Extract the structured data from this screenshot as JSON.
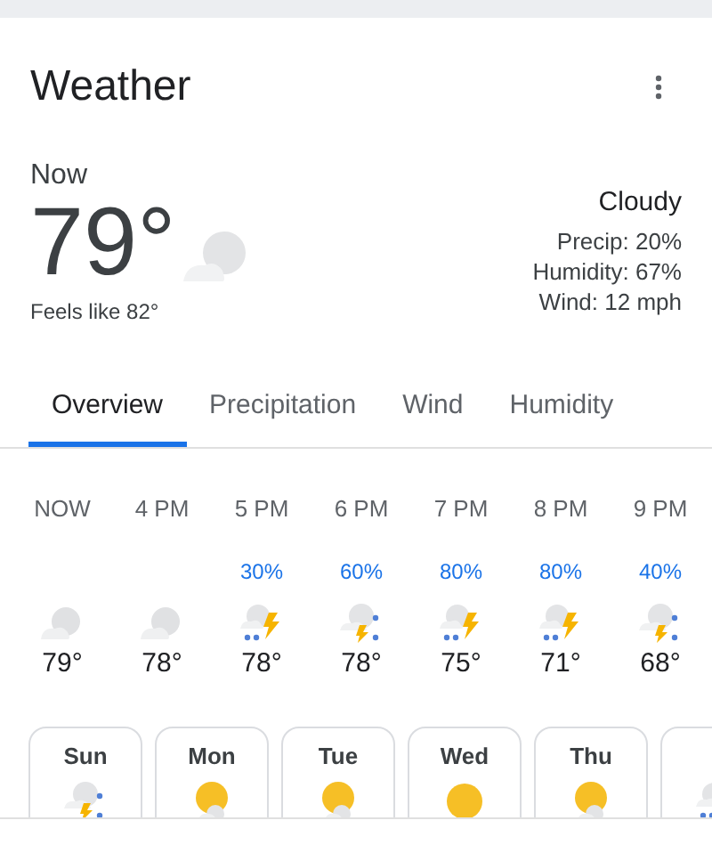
{
  "title": "Weather",
  "current": {
    "label": "Now",
    "temp": "79°",
    "kind": "cloudy",
    "feels_like": "Feels like 82°",
    "condition": "Cloudy",
    "details": [
      "Precip: 20%",
      "Humidity: 67%",
      "Wind: 12 mph"
    ]
  },
  "tabs": [
    {
      "label": "Overview",
      "selected": true
    },
    {
      "label": "Precipitation",
      "selected": false
    },
    {
      "label": "Wind",
      "selected": false
    },
    {
      "label": "Humidity",
      "selected": false
    }
  ],
  "hourly": [
    {
      "time": "NOW",
      "kind": "cloudy",
      "temp": "79°"
    },
    {
      "time": "4 PM",
      "kind": "cloudy",
      "temp": "78°"
    },
    {
      "time": "5 PM",
      "precip": "30%",
      "kind": "storm",
      "temp": "78°"
    },
    {
      "time": "6 PM",
      "precip": "60%",
      "kind": "storm-rain",
      "temp": "78°"
    },
    {
      "time": "7 PM",
      "precip": "80%",
      "kind": "storm",
      "temp": "75°"
    },
    {
      "time": "8 PM",
      "precip": "80%",
      "kind": "storm",
      "temp": "71°"
    },
    {
      "time": "9 PM",
      "precip": "40%",
      "kind": "storm-rain",
      "temp": "68°"
    }
  ],
  "daily": [
    {
      "day": "Sun",
      "kind": "storm-rain"
    },
    {
      "day": "Mon",
      "kind": "partly-sunny"
    },
    {
      "day": "Tue",
      "kind": "partly-sunny"
    },
    {
      "day": "Wed",
      "kind": "sunny"
    },
    {
      "day": "Thu",
      "kind": "partly-sunny"
    },
    {
      "kind": "storm"
    }
  ]
}
